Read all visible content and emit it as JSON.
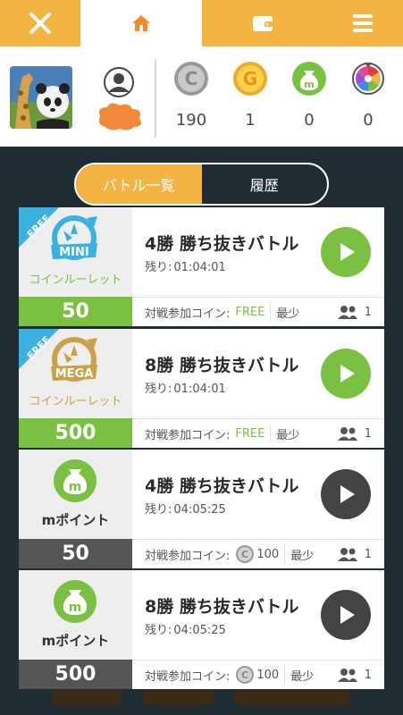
{
  "nav": {
    "items": [
      "close-icon",
      "home-icon",
      "wallet-icon",
      "menu-icon"
    ],
    "accent": "#f4b441"
  },
  "profile": {
    "stats": [
      {
        "icon": "coin-c-icon",
        "value": "190"
      },
      {
        "icon": "coin-g-icon",
        "value": "1"
      },
      {
        "icon": "m-bag-icon",
        "value": "0"
      },
      {
        "icon": "color-wheel-icon",
        "value": "0"
      }
    ]
  },
  "tabs": [
    {
      "label": "バトル一覧",
      "active": true
    },
    {
      "label": "履歴",
      "active": false
    }
  ],
  "cards": [
    {
      "type": "mini-roulette",
      "badge": "FREE",
      "badge_word": "MINI",
      "subtitle": "コインルーレット",
      "count": "50",
      "title": "4勝 勝ち抜きバトル",
      "remaining_label": "残り:",
      "remaining": "01:04:01",
      "fee_label": "対戦参加コイン:",
      "fee": "FREE",
      "min_label": "最少",
      "players": "1",
      "play_color": "#7ac143",
      "count_bg": "#7ac143"
    },
    {
      "type": "mega-roulette",
      "badge": "FREE",
      "badge_word": "MEGA",
      "subtitle": "コインルーレット",
      "count": "500",
      "title": "8勝 勝ち抜きバトル",
      "remaining_label": "残り:",
      "remaining": "01:04:01",
      "fee_label": "対戦参加コイン:",
      "fee": "FREE",
      "min_label": "最少",
      "players": "1",
      "play_color": "#7ac143",
      "count_bg": "#7ac143"
    },
    {
      "type": "mpoint",
      "subtitle": "mポイント",
      "count": "50",
      "title": "4勝 勝ち抜きバトル",
      "remaining_label": "残り:",
      "remaining": "04:05:25",
      "fee_label": "対戦参加コイン:",
      "fee": "100",
      "min_label": "最少",
      "players": "1",
      "play_color": "#444444",
      "count_bg": "#555555"
    },
    {
      "type": "mpoint",
      "subtitle": "mポイント",
      "count": "500",
      "title": "8勝 勝ち抜きバトル",
      "remaining_label": "残り:",
      "remaining": "04:05:25",
      "fee_label": "対戦参加コイン:",
      "fee": "100",
      "min_label": "最少",
      "players": "1",
      "play_color": "#444444",
      "count_bg": "#555555"
    }
  ]
}
